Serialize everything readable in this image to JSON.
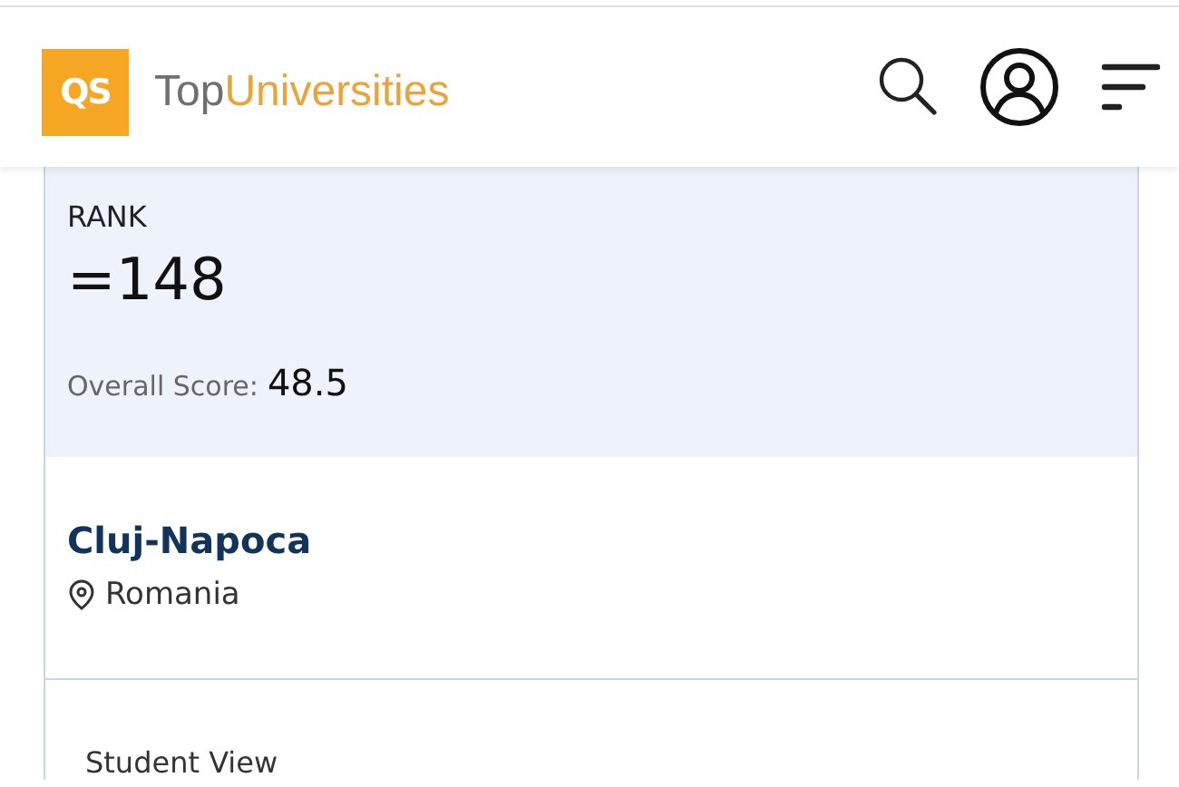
{
  "header": {
    "logo_badge": "QS",
    "logo_prefix": "Top",
    "logo_suffix": "Universities"
  },
  "rank": {
    "label": "RANK",
    "value": "=148",
    "score_label": "Overall Score:",
    "score_value": "48.5"
  },
  "location": {
    "city": "Cluj-Napoca",
    "country": "Romania"
  },
  "next_section": {
    "title": "Student View"
  }
}
